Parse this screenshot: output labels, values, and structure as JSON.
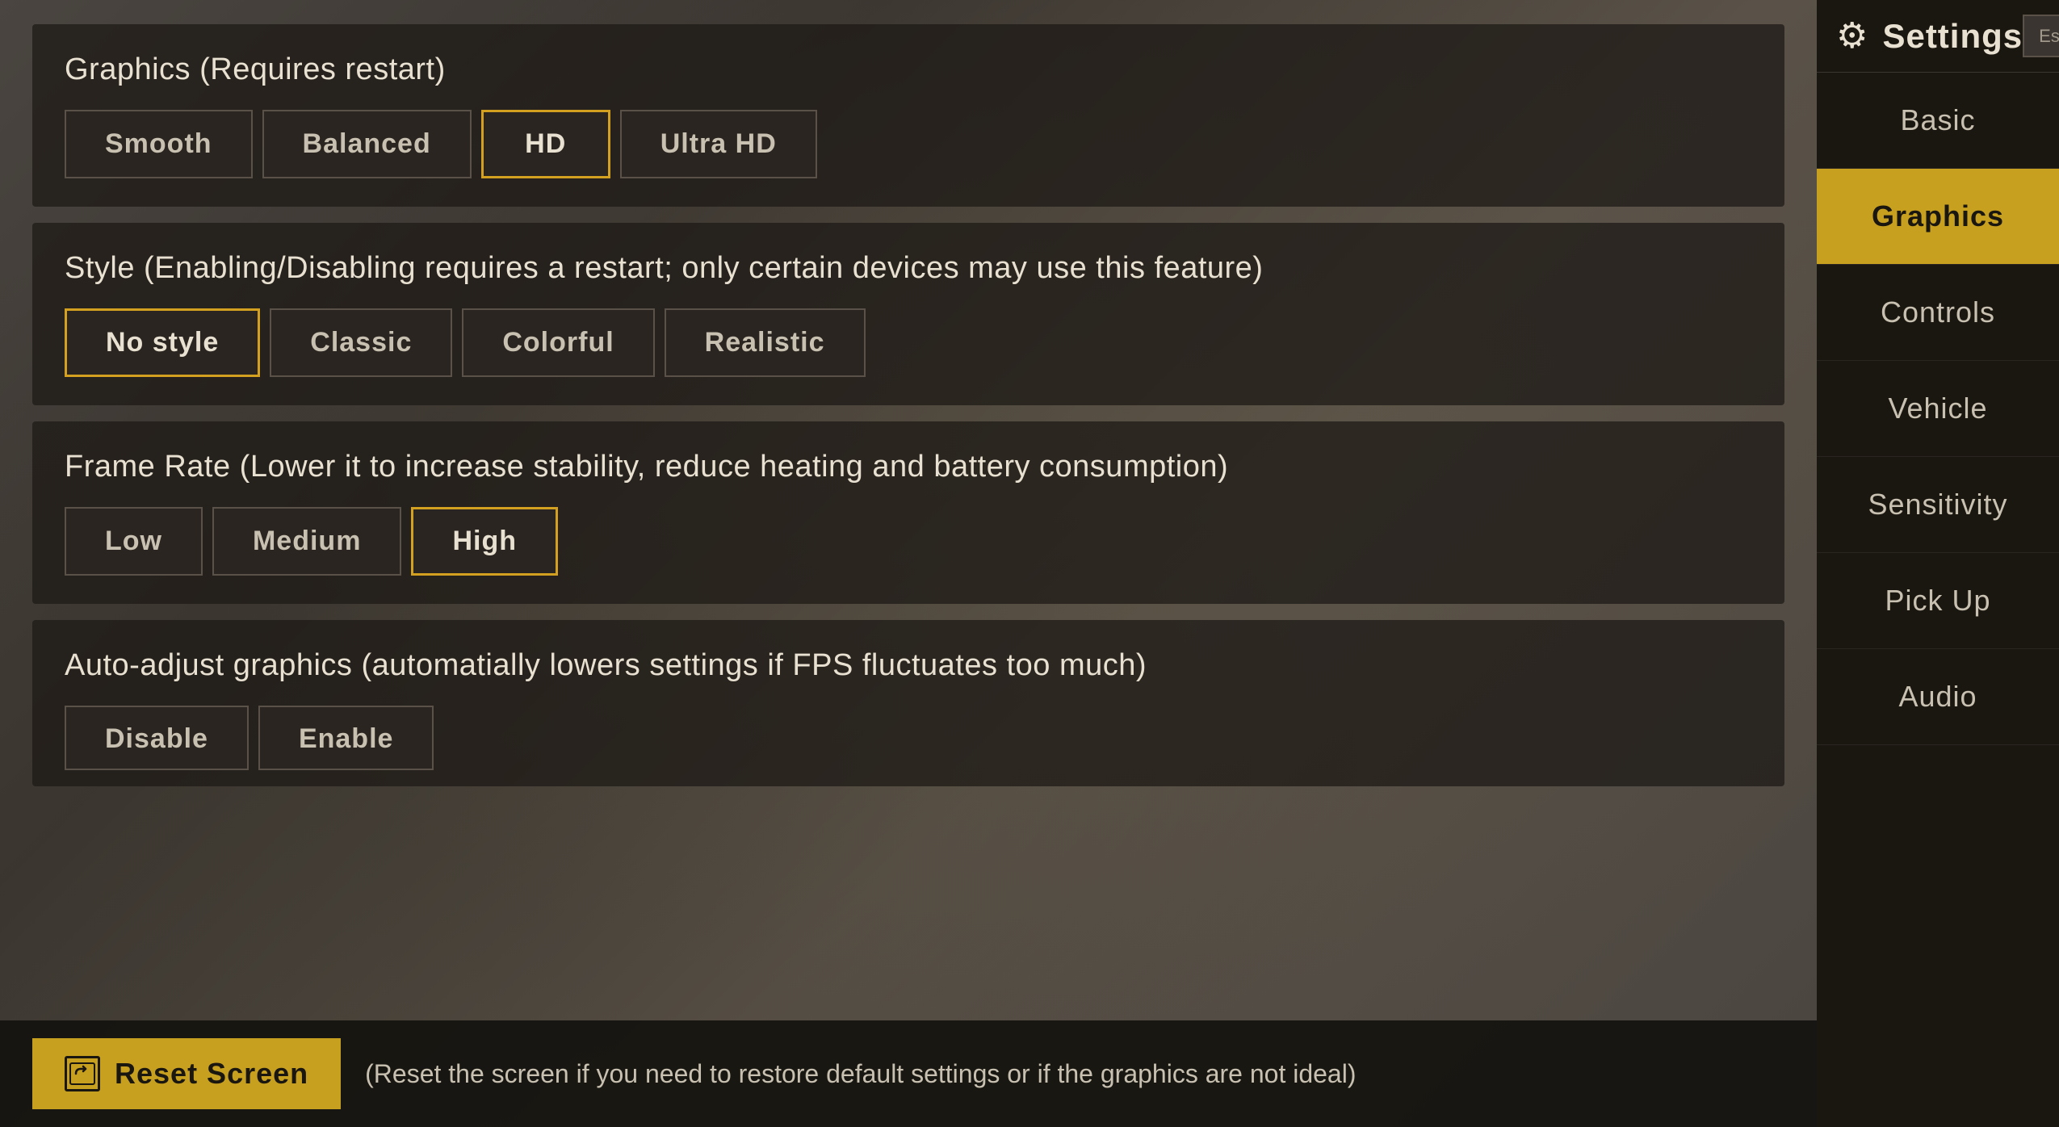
{
  "sidebar": {
    "header": {
      "title": "Settings",
      "esc_label": "Esc"
    },
    "nav_items": [
      {
        "id": "basic",
        "label": "Basic",
        "active": false
      },
      {
        "id": "graphics",
        "label": "Graphics",
        "active": true
      },
      {
        "id": "controls",
        "label": "Controls",
        "active": false
      },
      {
        "id": "vehicle",
        "label": "Vehicle",
        "active": false
      },
      {
        "id": "sensitivity",
        "label": "Sensitivity",
        "active": false
      },
      {
        "id": "pickup",
        "label": "Pick Up",
        "active": false
      },
      {
        "id": "audio",
        "label": "Audio",
        "active": false
      }
    ]
  },
  "sections": {
    "graphics": {
      "title": "Graphics (Requires restart)",
      "buttons": [
        {
          "id": "smooth",
          "label": "Smooth",
          "active": false
        },
        {
          "id": "balanced",
          "label": "Balanced",
          "active": false
        },
        {
          "id": "hd",
          "label": "HD",
          "active": true
        },
        {
          "id": "ultrahd",
          "label": "Ultra HD",
          "active": false
        }
      ]
    },
    "style": {
      "title": "Style (Enabling/Disabling requires a restart; only certain devices may use this feature)",
      "buttons": [
        {
          "id": "nostyle",
          "label": "No style",
          "active": true
        },
        {
          "id": "classic",
          "label": "Classic",
          "active": false
        },
        {
          "id": "colorful",
          "label": "Colorful",
          "active": false
        },
        {
          "id": "realistic",
          "label": "Realistic",
          "active": false
        }
      ]
    },
    "framerate": {
      "title": "Frame Rate (Lower it to increase stability, reduce heating and battery consumption)",
      "buttons": [
        {
          "id": "low",
          "label": "Low",
          "active": false
        },
        {
          "id": "medium",
          "label": "Medium",
          "active": false
        },
        {
          "id": "high",
          "label": "High",
          "active": true
        }
      ]
    },
    "autoadjust": {
      "title": "Auto-adjust graphics (automatially lowers settings if FPS fluctuates too much)",
      "buttons": [
        {
          "id": "disable",
          "label": "Disable",
          "active": false
        },
        {
          "id": "enable",
          "label": "Enable",
          "active": false
        }
      ]
    }
  },
  "bottom_bar": {
    "reset_label": "Reset Screen",
    "reset_desc": "(Reset the screen if you need to restore default settings or if the graphics are not ideal)"
  }
}
